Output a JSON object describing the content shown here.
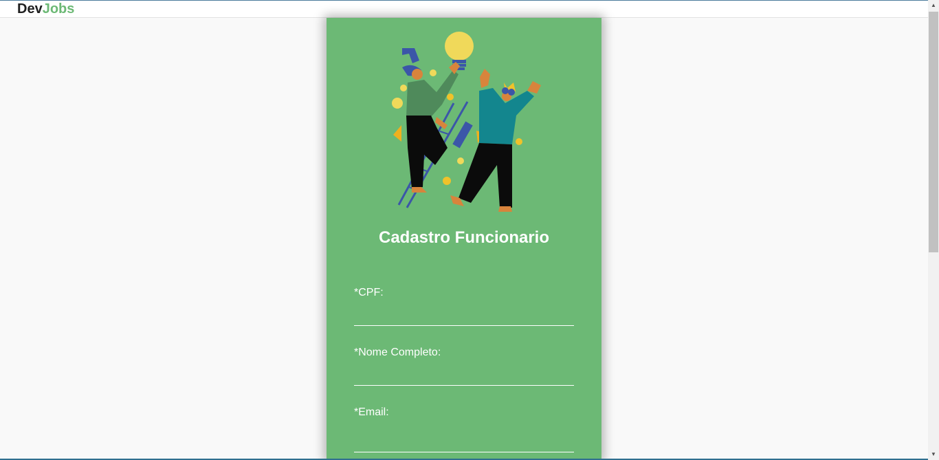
{
  "header": {
    "logo_part1": "Dev",
    "logo_part2": "Jobs"
  },
  "form": {
    "title": "Cadastro Funcionario",
    "fields": [
      {
        "label": "*CPF:",
        "value": ""
      },
      {
        "label": "*Nome Completo:",
        "value": ""
      },
      {
        "label": "*Email:",
        "value": ""
      }
    ]
  },
  "colors": {
    "card": "#6cb975",
    "accent_text": "#6cb975",
    "bulb": "#f0d95a"
  },
  "icons": {
    "scroll_up": "arrow-up-icon",
    "scroll_down": "arrow-down-icon"
  }
}
